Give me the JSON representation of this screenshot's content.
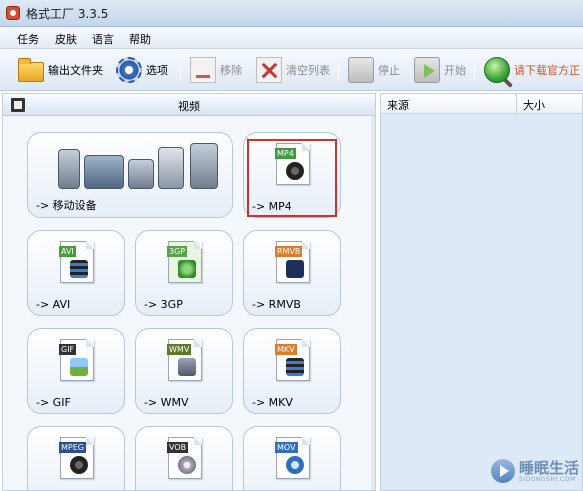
{
  "window": {
    "title": "格式工厂 3.3.5"
  },
  "menu": {
    "items": [
      "任务",
      "皮肤",
      "语言",
      "帮助"
    ]
  },
  "toolbar": {
    "output_folder": "输出文件夹",
    "options": "选项",
    "remove": "移除",
    "clear_list": "清空列表",
    "stop": "停止",
    "start": "开始",
    "download": "请下载官方正"
  },
  "panel": {
    "title": "视频",
    "tiles": [
      {
        "label": "-> 移动设备"
      },
      {
        "label": "-> MP4",
        "tag": "MP4",
        "tag_color": "#3f9a3f",
        "selected": true
      },
      {
        "label": "-> AVI",
        "tag": "AVI",
        "tag_color": "#4a9d3a"
      },
      {
        "label": "-> 3GP",
        "tag": "3GP",
        "tag_color": "#5aa34a"
      },
      {
        "label": "-> RMVB",
        "tag": "RMVB",
        "tag_color": "#e07b2a"
      },
      {
        "label": "-> GIF",
        "tag": "GIF",
        "tag_color": "#333333"
      },
      {
        "label": "-> WMV",
        "tag": "WMV",
        "tag_color": "#5b7a2a"
      },
      {
        "label": "-> MKV",
        "tag": "MKV",
        "tag_color": "#e07b2a"
      },
      {
        "tag": "MPEG",
        "tag_color": "#2a4f8a"
      },
      {
        "tag": "VOB",
        "tag_color": "#333333"
      },
      {
        "tag": "MOV",
        "tag_color": "#2f6fc0"
      }
    ]
  },
  "list": {
    "col_source": "来源",
    "col_size": "大小"
  },
  "watermark": {
    "text": "睡眠生活",
    "sub": "SIDONGSHI.COM"
  }
}
